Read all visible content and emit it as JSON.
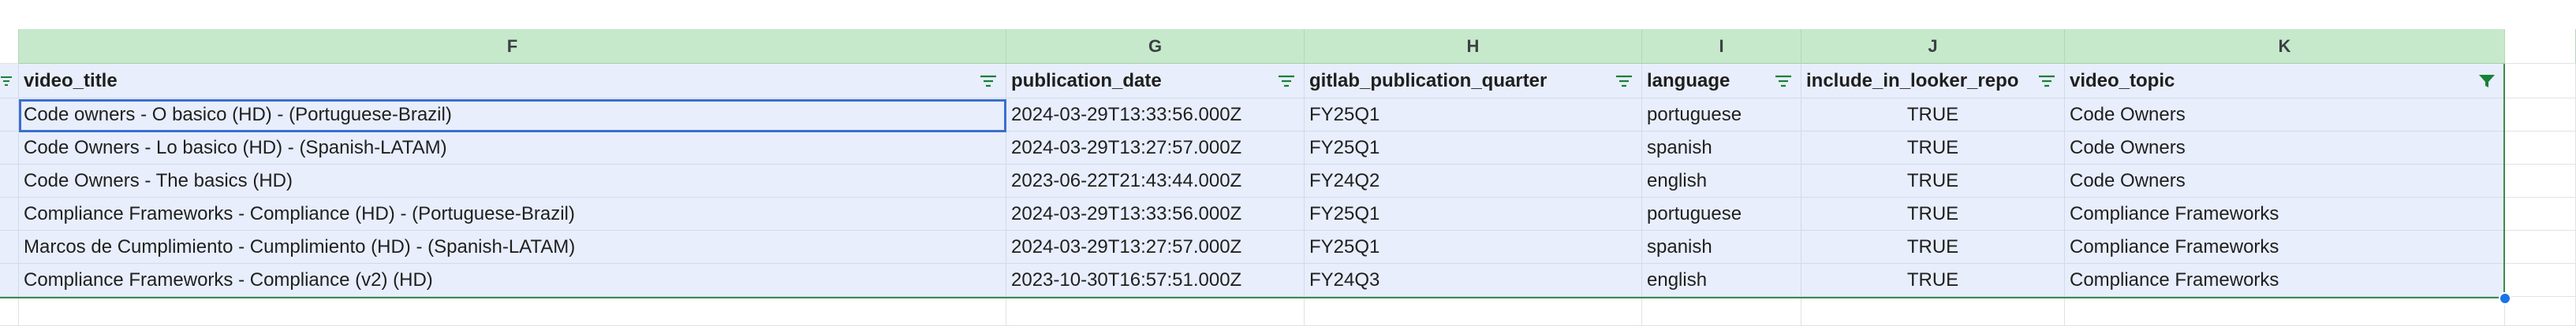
{
  "columns": [
    "F",
    "G",
    "H",
    "I",
    "J",
    "K"
  ],
  "header_row": [
    "video_title",
    "publication_date",
    "gitlab_publication_quarter",
    "language",
    "include_in_looker_repo",
    "video_topic"
  ],
  "rows": [
    [
      "Code owners - O basico (HD) - (Portuguese-Brazil)",
      "2024-03-29T13:33:56.000Z",
      "FY25Q1",
      "portuguese",
      "TRUE",
      "Code Owners"
    ],
    [
      "Code Owners - Lo basico (HD) - (Spanish-LATAM)",
      "2024-03-29T13:27:57.000Z",
      "FY25Q1",
      "spanish",
      "TRUE",
      "Code Owners"
    ],
    [
      "Code Owners - The basics (HD)",
      "2023-06-22T21:43:44.000Z",
      "FY24Q2",
      "english",
      "TRUE",
      "Code Owners"
    ],
    [
      "Compliance Frameworks - Compliance (HD) - (Portuguese-Brazil)",
      "2024-03-29T13:33:56.000Z",
      "FY25Q1",
      "portuguese",
      "TRUE",
      "Compliance Frameworks"
    ],
    [
      "Marcos de Cumplimiento - Cumplimiento (HD) - (Spanish-LATAM)",
      "2024-03-29T13:27:57.000Z",
      "FY25Q1",
      "spanish",
      "TRUE",
      "Compliance Frameworks"
    ],
    [
      "Compliance Frameworks - Compliance (v2) (HD)",
      "2023-10-30T16:57:51.000Z",
      "FY24Q3",
      "english",
      "TRUE",
      "Compliance Frameworks"
    ]
  ],
  "colors": {
    "column_header_bg": "#c6e9cc",
    "cell_bg": "#e8eefb",
    "selection_border": "#3b6fd0",
    "range_border": "#3a8a4c",
    "filter_icon": "#188038"
  },
  "icons": {
    "filter": "filter-lines-icon",
    "filter_active": "funnel-icon"
  }
}
